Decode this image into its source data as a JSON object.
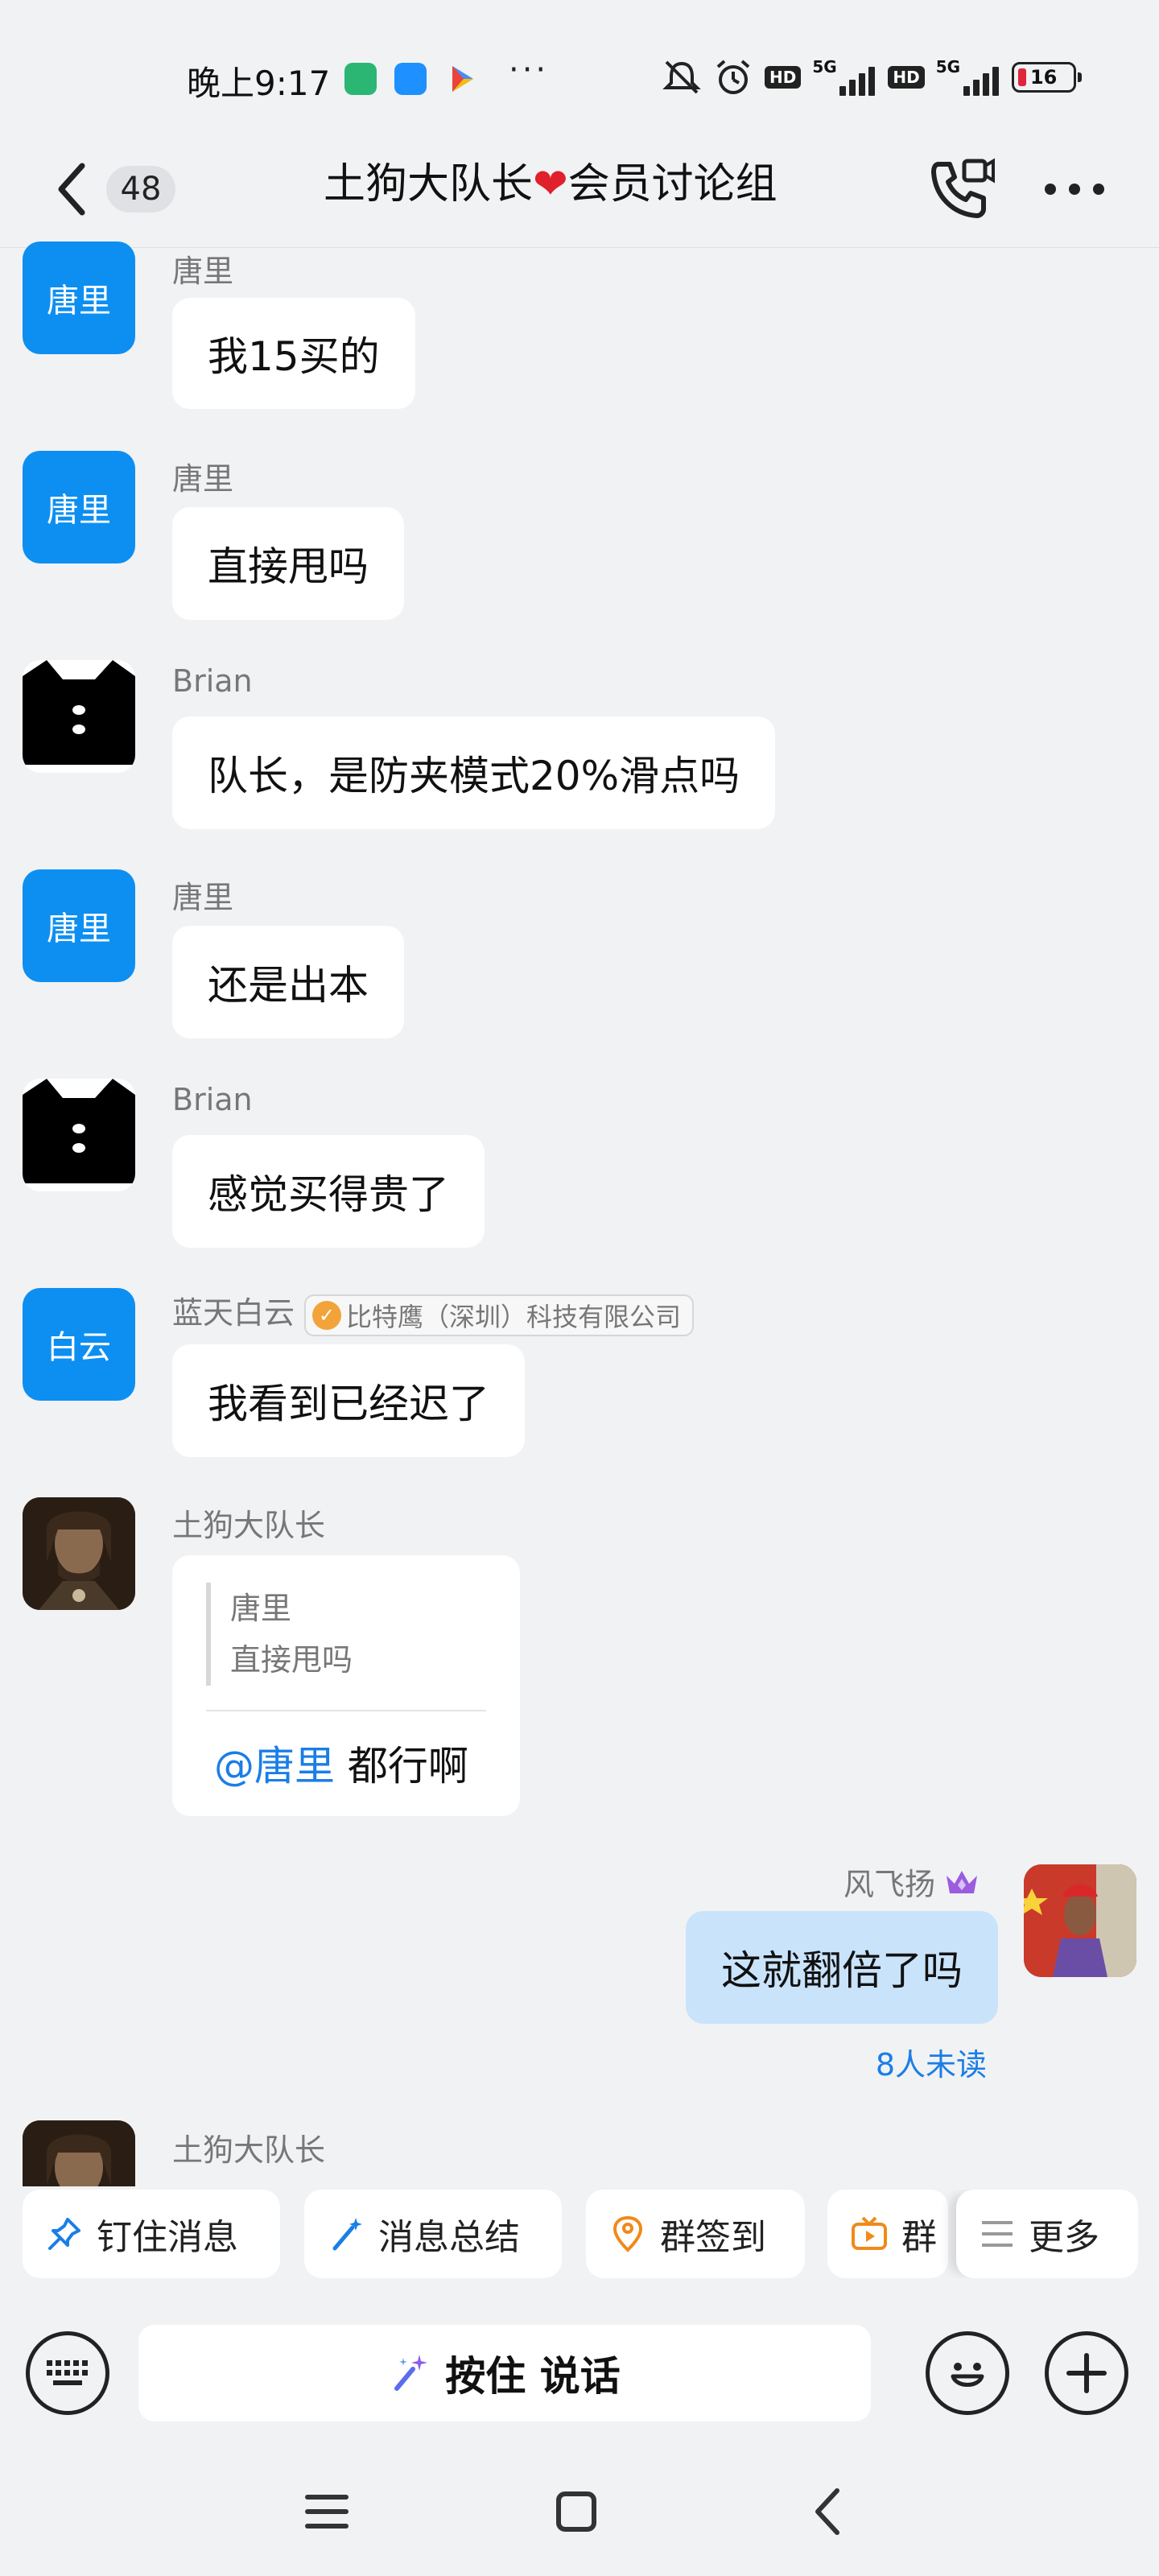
{
  "status_bar": {
    "time": "晚上9:17",
    "battery": "16",
    "more_dots": "···"
  },
  "header": {
    "unread_count": "48",
    "title_prefix": "土狗大队长",
    "title_suffix": "会员讨论组"
  },
  "messages": [
    {
      "sender": "唐里",
      "avatar_text": "唐里",
      "text": "我15买的"
    },
    {
      "sender": "唐里",
      "avatar_text": "唐里",
      "text": "直接甩吗"
    },
    {
      "sender": "Brian",
      "text": "队长，是防夹模式20%滑点吗"
    },
    {
      "sender": "唐里",
      "avatar_text": "唐里",
      "text": "还是出本"
    },
    {
      "sender": "Brian",
      "text": "感觉买得贵了"
    },
    {
      "sender": "蓝天白云",
      "avatar_text": "白云",
      "tag": "比特鹰（深圳）科技有限公司",
      "text": "我看到已经迟了"
    },
    {
      "sender": "土狗大队长",
      "quote_name": "唐里",
      "quote_text": "直接甩吗",
      "mention": "@唐里",
      "text": " 都行啊"
    },
    {
      "sender": "风飞扬",
      "text": "这就翻倍了吗",
      "read_status": "8人未读",
      "self": true
    },
    {
      "sender": "土狗大队长"
    }
  ],
  "quick_actions": [
    "钉住消息",
    "消息总结",
    "群签到",
    "群",
    "更多"
  ],
  "input": {
    "talk_label": "按住 说话"
  },
  "colors": {
    "accent": "#1a7ee6",
    "avatar_blue": "#0d8ff2",
    "self_bubble": "#c9e3fb",
    "background": "#f1f2f4"
  }
}
